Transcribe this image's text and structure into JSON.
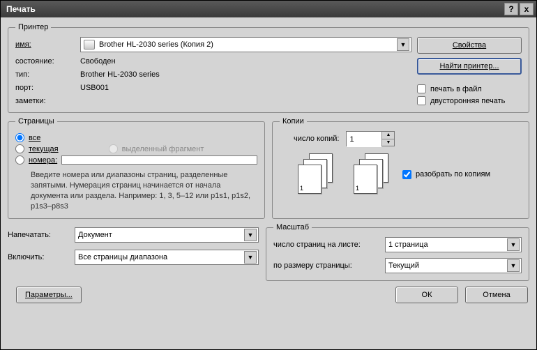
{
  "title": "Печать",
  "titlebar": {
    "help": "?",
    "close": "x"
  },
  "printer": {
    "legend": "Принтер",
    "name_label": "имя:",
    "name_value": "Brother HL-2030 series (Копия 2)",
    "state_label": "состояние:",
    "state_value": "Свободен",
    "type_label": "тип:",
    "type_value": "Brother HL-2030 series",
    "port_label": "порт:",
    "port_value": "USB001",
    "notes_label": "заметки:",
    "notes_value": "",
    "properties_btn": "Свойства",
    "find_printer_btn": "Найти принтер...",
    "print_to_file": "печать в файл",
    "duplex": "двусторонняя печать"
  },
  "pages": {
    "legend": "Страницы",
    "all": "все",
    "current": "текущая",
    "selection": "выделенный фрагмент",
    "numbers": "номера:",
    "numbers_value": "",
    "hint": "Введите номера или диапазоны страниц, разделенные запятыми. Нумерация страниц начинается от начала документа или раздела. Например: 1, 3, 5–12 или p1s1, p1s2, p1s3–p8s3"
  },
  "copies": {
    "legend": "Копии",
    "count_label": "число копий:",
    "count_value": "1",
    "collate": "разобрать по копиям"
  },
  "print_what": {
    "label": "Напечатать:",
    "value": "Документ"
  },
  "include": {
    "label": "Включить:",
    "value": "Все страницы диапазона"
  },
  "scale": {
    "legend": "Масштаб",
    "pages_per_sheet_label": "число страниц на листе:",
    "pages_per_sheet_value": "1 страница",
    "fit_to_label": "по размеру страницы:",
    "fit_to_value": "Текущий"
  },
  "footer": {
    "options_btn": "Параметры...",
    "ok_btn": "ОК",
    "cancel_btn": "Отмена"
  }
}
